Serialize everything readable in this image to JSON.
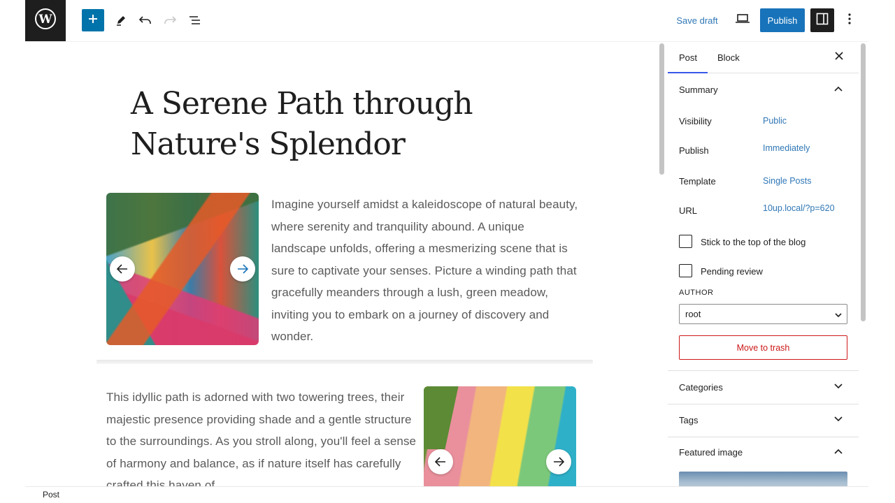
{
  "toolbar": {
    "logo_icon": "wordpress-icon",
    "inserter_icon": "plus-icon",
    "tools_icon": "pencil-icon",
    "undo_icon": "undo-icon",
    "redo_icon": "redo-icon",
    "list_view_icon": "list-view-icon",
    "save_draft_label": "Save draft",
    "preview_icon": "laptop-icon",
    "publish_label": "Publish",
    "settings_icon": "sidebar-icon",
    "options_icon": "more-vertical-icon",
    "accent_color": "#1873ba"
  },
  "post": {
    "title": "A Serene Path through Nature's Splendor",
    "paragraph1": "Imagine yourself amidst a kaleidoscope of natural beauty, where serenity and tranquility abound. A unique landscape unfolds, offering a mesmerizing scene that is sure to captivate your senses. Picture a winding path that gracefully meanders through a lush, green meadow, inviting you to embark on a journey of discovery and wonder.",
    "paragraph2": "This idyllic path is adorned with two towering trees, their majestic presence providing shade and a gentle structure to the surroundings. As you stroll along, you'll feel a sense of harmony and balance, as if nature itself has carefully crafted this haven of"
  },
  "sidebar": {
    "tabs": [
      {
        "label": "Post"
      },
      {
        "label": "Block"
      }
    ],
    "summary": {
      "title": "Summary",
      "rows": [
        {
          "label": "Visibility",
          "value": "Public"
        },
        {
          "label": "Publish",
          "value": "Immediately"
        },
        {
          "label": "Template",
          "value": "Single Posts"
        },
        {
          "label": "URL",
          "value": "10up.local/?p=620"
        }
      ],
      "sticky_label": "Stick to the top of the blog",
      "pending_label": "Pending review",
      "author_label": "AUTHOR",
      "author_value": "root",
      "trash_label": "Move to trash"
    },
    "panels": {
      "categories": "Categories",
      "tags": "Tags",
      "featured_image": "Featured image"
    }
  },
  "footer": {
    "breadcrumb": "Post"
  }
}
